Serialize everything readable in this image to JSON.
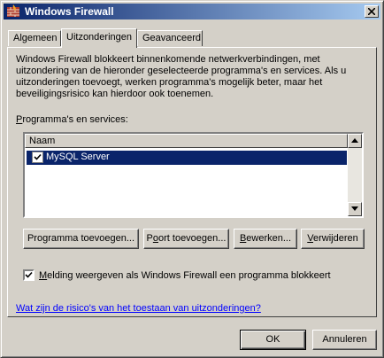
{
  "window": {
    "title": "Windows Firewall"
  },
  "tabs": [
    {
      "label": "Algemeen",
      "active": false
    },
    {
      "label": "Uitzonderingen",
      "active": true
    },
    {
      "label": "Geavanceerd",
      "active": false
    }
  ],
  "description": "Windows Firewall blokkeert binnenkomende netwerkverbindingen, met uitzondering van de hieronder geselecteerde programma's en services. Als u uitzonderingen toevoegt, werken programma's mogelijk beter, maar het beveiligingsrisico kan hierdoor ook toenemen.",
  "programs": {
    "label_key": "P",
    "label_rest": "rogramma's en services:",
    "column_header": "Naam",
    "items": [
      {
        "name": "MySQL Server",
        "checked": true,
        "selected": true
      }
    ]
  },
  "buttons": {
    "add_program": {
      "pre": "Programma toevoegen...",
      "key": ""
    },
    "add_port": {
      "pre": "P",
      "key": "o",
      "post": "ort toevoegen..."
    },
    "edit": {
      "pre": "",
      "key": "B",
      "post": "ewerken..."
    },
    "delete": {
      "pre": "",
      "key": "V",
      "post": "erwijderen"
    }
  },
  "notify": {
    "checked": true,
    "key": "M",
    "rest": "elding weergeven als Windows Firewall een programma blokkeert"
  },
  "link": "Wat zijn de risico's van het toestaan van uitzonderingen?",
  "footer": {
    "ok": "OK",
    "cancel": "Annuleren"
  }
}
